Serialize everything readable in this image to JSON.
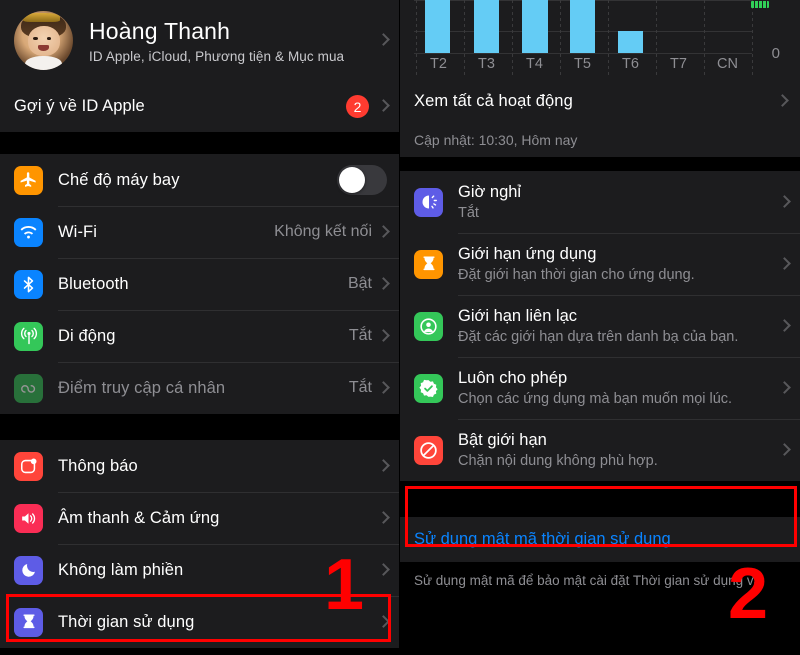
{
  "left_panel": {
    "profile": {
      "name": "Hoàng Thanh",
      "subtitle": "ID Apple, iCloud, Phương tiện & Mục mua",
      "avatar_name": "user-avatar-photo"
    },
    "apple_id_suggestion": {
      "label": "Gợi ý về ID Apple",
      "badge": "2"
    },
    "connectivity": [
      {
        "label": "Chế độ máy bay",
        "value": "",
        "icon": "airplane-icon",
        "icon_color": "#ff9500",
        "control": "toggle",
        "toggle_on": false
      },
      {
        "label": "Wi-Fi",
        "value": "Không kết nối",
        "icon": "wifi-icon",
        "icon_color": "#0a84ff",
        "control": "chevron"
      },
      {
        "label": "Bluetooth",
        "value": "Bật",
        "icon": "bluetooth-icon",
        "icon_color": "#0a84ff",
        "control": "chevron"
      },
      {
        "label": "Di động",
        "value": "Tắt",
        "icon": "cellular-icon",
        "icon_color": "#34c759",
        "control": "chevron"
      },
      {
        "label": "Điểm truy cập cá nhân",
        "value": "Tắt",
        "icon": "hotspot-icon",
        "icon_color": "#34c759",
        "control": "chevron",
        "dimmed": true
      }
    ],
    "system": [
      {
        "label": "Thông báo",
        "icon": "notifications-icon",
        "icon_color": "#ff453a",
        "control": "chevron"
      },
      {
        "label": "Âm thanh & Cảm ứng",
        "icon": "sound-icon",
        "icon_color": "#fa2d55",
        "control": "chevron"
      },
      {
        "label": "Không làm phiền",
        "icon": "moon-icon",
        "icon_color": "#5e5ce6",
        "control": "chevron"
      },
      {
        "label": "Thời gian sử dụng",
        "icon": "hourglass-icon",
        "icon_color": "#5e5ce6",
        "control": "chevron",
        "highlighted": true
      }
    ],
    "annotation": {
      "number": "1",
      "color": "#ff0000"
    }
  },
  "right_panel": {
    "chart_data": {
      "type": "bar",
      "title": "",
      "categories": [
        "T2",
        "T3",
        "T4",
        "T5",
        "T6",
        "T7",
        "CN"
      ],
      "values": [
        100,
        100,
        100,
        100,
        46,
        0,
        0
      ],
      "ylabel": "",
      "xlabel": "",
      "ytick_labels": [
        "0"
      ],
      "ylim": [
        0,
        100
      ],
      "grid": true,
      "bar_color": "#64ccf5",
      "legend": []
    },
    "see_all_activity": {
      "label": "Xem tất cả hoạt động"
    },
    "updated": "Cập nhật: 10:30, Hôm nay",
    "items": [
      {
        "title": "Giờ nghỉ",
        "subtitle": "Tắt",
        "icon": "downtime-icon",
        "icon_color": "#5e5ce6"
      },
      {
        "title": "Giới hạn ứng dụng",
        "subtitle": "Đặt giới hạn thời gian cho ứng dụng.",
        "icon": "app-limits-hourglass-icon",
        "icon_color": "#ff9500"
      },
      {
        "title": "Giới hạn liên lạc",
        "subtitle": "Đặt các giới hạn dựa trên danh bạ của bạn.",
        "icon": "communication-limits-person-icon",
        "icon_color": "#34c759"
      },
      {
        "title": "Luôn cho phép",
        "subtitle": "Chọn các ứng dụng mà bạn muốn mọi lúc.",
        "icon": "always-allowed-check-icon",
        "icon_color": "#34c759"
      },
      {
        "title": "Bật giới hạn",
        "subtitle": "Chặn nội dung không phù hợp.",
        "icon": "content-restrictions-block-icon",
        "icon_color": "#ff453a",
        "highlighted": true
      }
    ],
    "passcode_link": "Sử dụng mật mã thời gian sử dụng",
    "passcode_note": "Sử dụng mật mã để bảo mật cài đặt Thời gian sử dụng và",
    "annotation": {
      "number": "2",
      "color": "#ff0000"
    }
  }
}
